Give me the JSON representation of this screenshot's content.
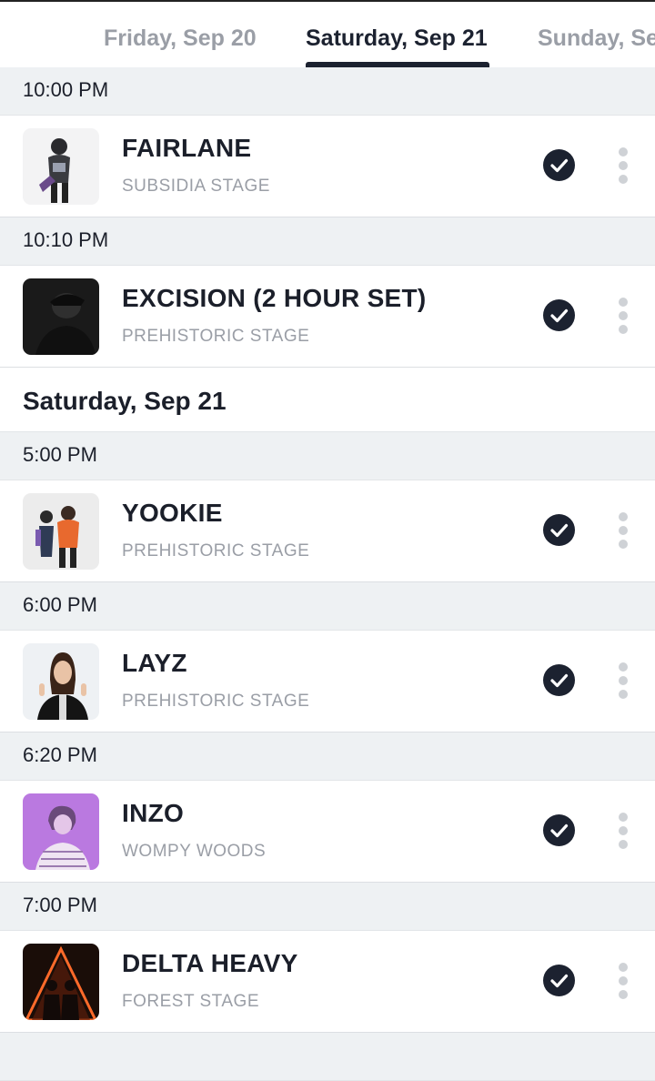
{
  "tabs": [
    {
      "label": "Friday, Sep 20"
    },
    {
      "label": "Saturday, Sep 21",
      "selected": true
    },
    {
      "label": "Sunday, Se"
    }
  ],
  "day_header": "Saturday, Sep 21",
  "slots": [
    {
      "time": "10:00 PM",
      "artist": "FAIRLANE",
      "stage": "SUBSIDIA STAGE",
      "saved": true
    },
    {
      "time": "10:10 PM",
      "artist": "EXCISION (2 HOUR SET)",
      "stage": "PREHISTORIC STAGE",
      "saved": true
    },
    {
      "time": "5:00 PM",
      "artist": "YOOKIE",
      "stage": "PREHISTORIC STAGE",
      "saved": true
    },
    {
      "time": "6:00 PM",
      "artist": "LAYZ",
      "stage": "PREHISTORIC STAGE",
      "saved": true
    },
    {
      "time": "6:20 PM",
      "artist": "INZO",
      "stage": "WOMPY WOODS",
      "saved": true
    },
    {
      "time": "7:00 PM",
      "artist": "DELTA HEAVY",
      "stage": "FOREST STAGE",
      "saved": true
    }
  ],
  "icons": {
    "saved": "check-circle-icon",
    "more": "more-vertical-icon"
  },
  "colors": {
    "accent": "#1c2230",
    "section_bg": "#eef1f3",
    "muted_text": "#9a9ea6"
  }
}
